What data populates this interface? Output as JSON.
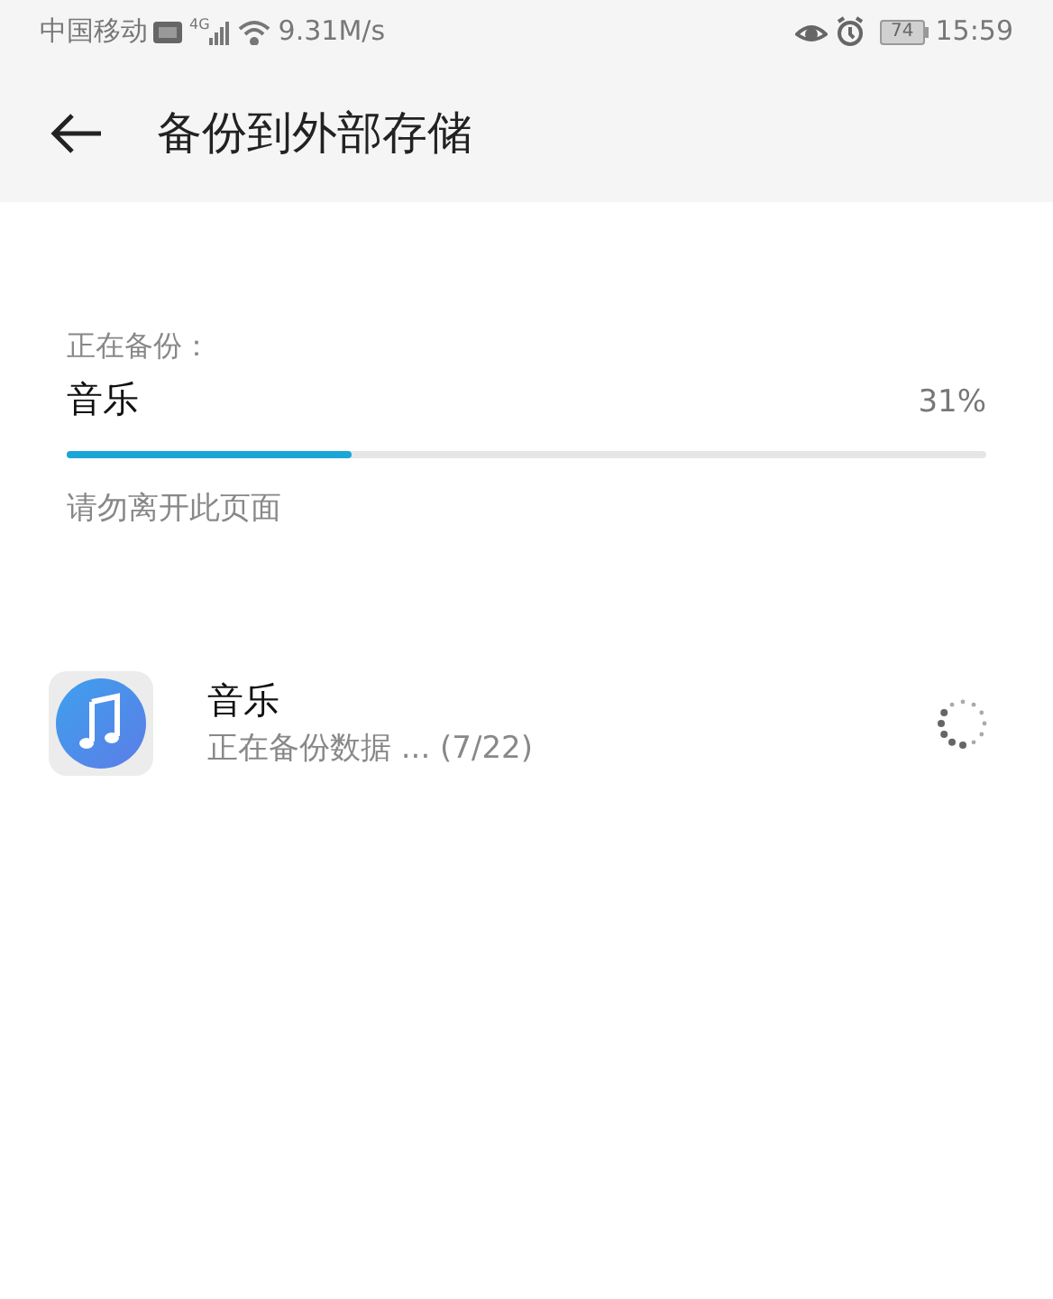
{
  "status_bar": {
    "carrier": "中国移动",
    "network": "4G",
    "speed": "9.31M/s",
    "battery": "74",
    "time": "15:59"
  },
  "header": {
    "title": "备份到外部存储"
  },
  "progress": {
    "caption": "正在备份：",
    "item": "音乐",
    "percent": "31%",
    "level": 0.31,
    "warning": "请勿离开此页面"
  },
  "items": [
    {
      "name": "音乐",
      "status": "正在备份数据 ... (7/22)"
    }
  ]
}
